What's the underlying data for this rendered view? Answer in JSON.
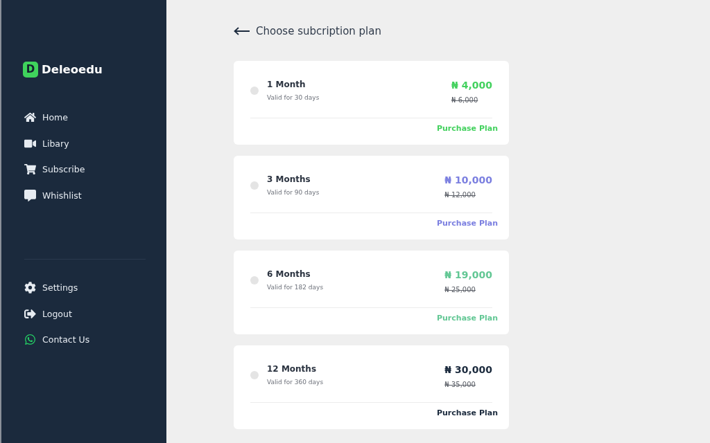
{
  "sidebar": {
    "logo_letter": "D",
    "brand": "Deleoedu",
    "nav_items": [
      {
        "label": "Home",
        "selected": false
      },
      {
        "label": "Libary",
        "selected": false
      },
      {
        "label": "Subscribe",
        "selected": false
      },
      {
        "label": "Whishlist",
        "selected": false
      }
    ],
    "bottom_items": [
      {
        "label": "Settings",
        "selected": false
      },
      {
        "label": "Logout",
        "selected": false
      },
      {
        "label": "Contact Us",
        "selected": false
      }
    ]
  },
  "header": {
    "title": "Choose subcription plan"
  },
  "plans": [
    {
      "name": "1 Month",
      "validity": "Valid for 30 days",
      "price": "₦ 4,000",
      "old_price": "₦ 6,000",
      "action": "Purchase Plan",
      "color": "#43d15e",
      "selected": false
    },
    {
      "name": "3 Months",
      "validity": "Valid for 90 days",
      "price": "₦ 10,000",
      "old_price": "₦ 12,000",
      "action": "Purchase Plan",
      "color": "#7b7fe0",
      "selected": false
    },
    {
      "name": "6 Months",
      "validity": "Valid for 182 days",
      "price": "₦ 19,000",
      "old_price": "₦ 25,000",
      "action": "Purchase Plan",
      "color": "#62c794",
      "selected": false
    },
    {
      "name": "12 Months",
      "validity": "Valid for 360 days",
      "price": "₦ 30,000",
      "old_price": "₦ 35,000",
      "action": "Purchase Plan",
      "color": "#1b2a3d",
      "selected": false
    }
  ]
}
